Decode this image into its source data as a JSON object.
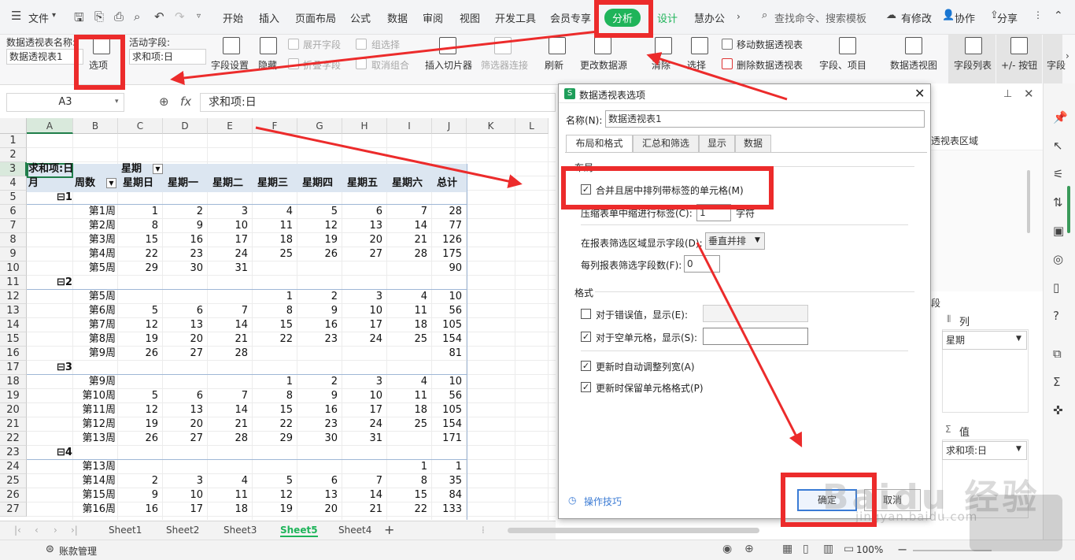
{
  "menubar": {
    "file_label": "文件",
    "tabs": [
      "开始",
      "插入",
      "页面布局",
      "公式",
      "数据",
      "审阅",
      "视图",
      "开发工具",
      "会员专享",
      "分析",
      "设计",
      "慧办公"
    ],
    "search_placeholder": "查找命令、搜索模板",
    "has_changes": "有修改",
    "collab": "协作",
    "share": "分享",
    "active_tab_color": "#1fb45a"
  },
  "ribbon": {
    "pivot_name_label": "数据透视表名称:",
    "pivot_name_value": "数据透视表1",
    "options_label": "选项",
    "active_field_label": "活动字段:",
    "active_field_value": "求和项:日",
    "field_settings": "字段设置",
    "hide": "隐藏",
    "expand_field": "展开字段",
    "collapse_field": "折叠字段",
    "group_selection": "组选择",
    "ungroup": "取消组合",
    "insert_slicer": "插入切片器",
    "filter_connection": "筛选器连接",
    "refresh": "刷新",
    "change_source": "更改数据源",
    "clear": "清除",
    "select": "选择",
    "move_pivot": "移动数据透视表",
    "delete_pivot": "删除数据透视表",
    "fields_items": "字段、项目",
    "pivot_chart": "数据透视图",
    "field_list": "字段列表",
    "plus_minus_buttons": "+/- 按钮",
    "field_headers": "字段"
  },
  "formula": {
    "name_box": "A3",
    "fx": "fx",
    "content": "求和项:日"
  },
  "grid": {
    "columns": [
      "A",
      "B",
      "C",
      "D",
      "E",
      "F",
      "G",
      "H",
      "I",
      "J",
      "K",
      "L"
    ],
    "row_numbers": [
      "1",
      "2",
      "3",
      "4",
      "5",
      "6",
      "7",
      "8",
      "9",
      "10",
      "11",
      "12",
      "13",
      "14",
      "15",
      "16",
      "17",
      "18",
      "19",
      "20",
      "21",
      "22",
      "23",
      "24",
      "25",
      "26",
      "27"
    ],
    "header_row3": {
      "a": "求和项:日",
      "c": "星期"
    },
    "header_row4": [
      "月",
      "周数",
      "星期日",
      "星期一",
      "星期二",
      "星期三",
      "星期四",
      "星期五",
      "星期六",
      "总计"
    ],
    "rows": [
      {
        "r": 5,
        "group": "1"
      },
      {
        "r": 6,
        "week": "第1周",
        "vals": [
          "1",
          "2",
          "3",
          "4",
          "5",
          "6",
          "7",
          "28"
        ]
      },
      {
        "r": 7,
        "week": "第2周",
        "vals": [
          "8",
          "9",
          "10",
          "11",
          "12",
          "13",
          "14",
          "77"
        ]
      },
      {
        "r": 8,
        "week": "第3周",
        "vals": [
          "15",
          "16",
          "17",
          "18",
          "19",
          "20",
          "21",
          "126"
        ]
      },
      {
        "r": 9,
        "week": "第4周",
        "vals": [
          "22",
          "23",
          "24",
          "25",
          "26",
          "27",
          "28",
          "175"
        ]
      },
      {
        "r": 10,
        "week": "第5周",
        "vals": [
          "29",
          "30",
          "31",
          "",
          "",
          "",
          "",
          "90"
        ]
      },
      {
        "r": 11,
        "group": "2"
      },
      {
        "r": 12,
        "week": "第5周",
        "vals": [
          "",
          "",
          "",
          "1",
          "2",
          "3",
          "4",
          "10"
        ]
      },
      {
        "r": 13,
        "week": "第6周",
        "vals": [
          "5",
          "6",
          "7",
          "8",
          "9",
          "10",
          "11",
          "56"
        ]
      },
      {
        "r": 14,
        "week": "第7周",
        "vals": [
          "12",
          "13",
          "14",
          "15",
          "16",
          "17",
          "18",
          "105"
        ]
      },
      {
        "r": 15,
        "week": "第8周",
        "vals": [
          "19",
          "20",
          "21",
          "22",
          "23",
          "24",
          "25",
          "154"
        ]
      },
      {
        "r": 16,
        "week": "第9周",
        "vals": [
          "26",
          "27",
          "28",
          "",
          "",
          "",
          "",
          "81"
        ]
      },
      {
        "r": 17,
        "group": "3"
      },
      {
        "r": 18,
        "week": "第9周",
        "vals": [
          "",
          "",
          "",
          "1",
          "2",
          "3",
          "4",
          "10"
        ]
      },
      {
        "r": 19,
        "week": "第10周",
        "vals": [
          "5",
          "6",
          "7",
          "8",
          "9",
          "10",
          "11",
          "56"
        ]
      },
      {
        "r": 20,
        "week": "第11周",
        "vals": [
          "12",
          "13",
          "14",
          "15",
          "16",
          "17",
          "18",
          "105"
        ]
      },
      {
        "r": 21,
        "week": "第12周",
        "vals": [
          "19",
          "20",
          "21",
          "22",
          "23",
          "24",
          "25",
          "154"
        ]
      },
      {
        "r": 22,
        "week": "第13周",
        "vals": [
          "26",
          "27",
          "28",
          "29",
          "30",
          "31",
          "",
          "171"
        ]
      },
      {
        "r": 23,
        "group": "4"
      },
      {
        "r": 24,
        "week": "第13周",
        "vals": [
          "",
          "",
          "",
          "",
          "",
          "",
          "1",
          "1"
        ]
      },
      {
        "r": 25,
        "week": "第14周",
        "vals": [
          "2",
          "3",
          "4",
          "5",
          "6",
          "7",
          "8",
          "35"
        ]
      },
      {
        "r": 26,
        "week": "第15周",
        "vals": [
          "9",
          "10",
          "11",
          "12",
          "13",
          "14",
          "15",
          "84"
        ]
      },
      {
        "r": 27,
        "week": "第16周",
        "vals": [
          "16",
          "17",
          "18",
          "19",
          "20",
          "21",
          "22",
          "133"
        ]
      }
    ]
  },
  "sheets": {
    "tabs": [
      "Sheet1",
      "Sheet2",
      "Sheet3",
      "Sheet5",
      "Sheet4"
    ],
    "active": "Sheet5"
  },
  "status": {
    "account": "账款管理",
    "zoom": "100%"
  },
  "dialog": {
    "title": "数据透视表选项",
    "name_label": "名称(N):",
    "name_value": "数据透视表1",
    "tabs": [
      "布局和格式",
      "汇总和筛选",
      "显示",
      "数据"
    ],
    "layout_section": "布局",
    "merge_center": "合并且居中排列带标签的单元格(M)",
    "indent_label": "压缩表单中缩进行标签(C):",
    "indent_value": "1",
    "indent_unit": "字符",
    "filter_display_label": "在报表筛选区域显示字段(D):",
    "filter_display_value": "垂直并排",
    "filter_count_label": "每列报表筛选字段数(F):",
    "filter_count_value": "0",
    "format_section": "格式",
    "error_label": "对于错误值，显示(E):",
    "empty_label": "对于空单元格，显示(S):",
    "autofit": "更新时自动调整列宽(A)",
    "preserve_format": "更新时保留单元格格式(P)",
    "tips": "操作技巧",
    "ok": "确定",
    "cancel": "取消"
  },
  "rightpane": {
    "area_label": "透视表区域",
    "columns_label": "列",
    "column_field": "星期",
    "values_label": "值",
    "value_field": "求和项:日",
    "side_text": "段"
  },
  "watermark": {
    "text": "Baidu 经验",
    "url": "jingyan.baidu.com"
  },
  "annotation_color": "#ec2b2b"
}
